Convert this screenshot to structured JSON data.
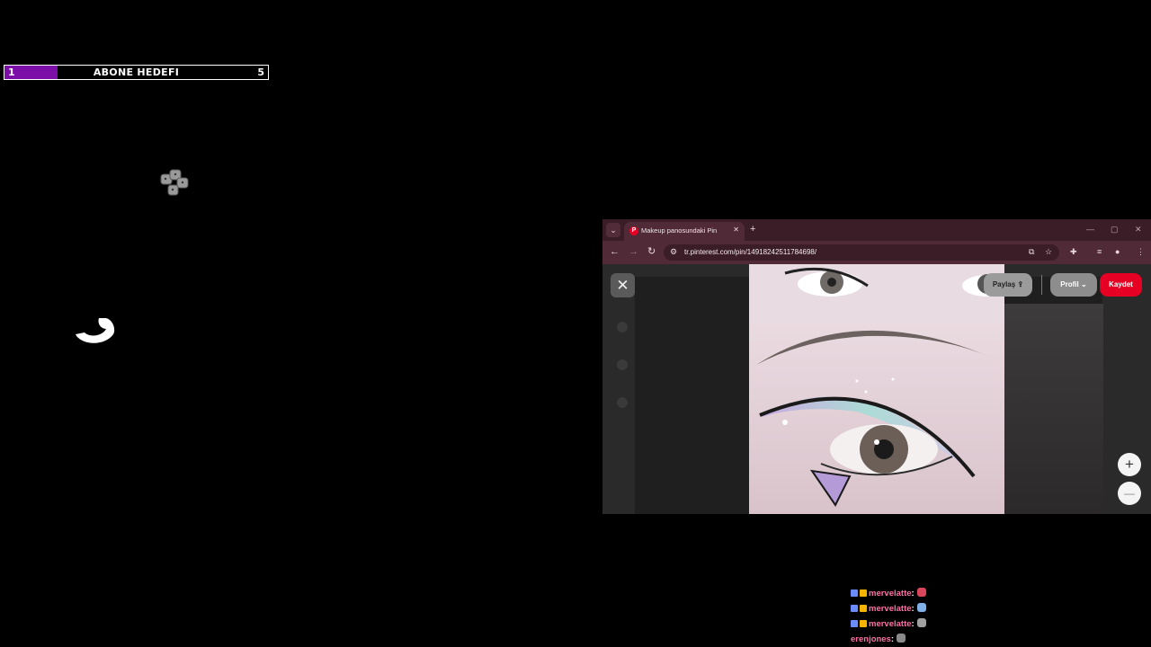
{
  "goal": {
    "start_label": "1",
    "title": "ABONE HEDEFI",
    "end_label": "5",
    "progress": 0.2
  },
  "browser": {
    "tab_title": "Makeup panosundaki Pin",
    "url": "tr.pinterest.com/pin/14918242511784698/",
    "share_label": "Paylaş",
    "profile_label": "Profil",
    "save_label": "Kaydet",
    "zoom_in_label": "+",
    "zoom_out_label": "—",
    "accent_color": "#e60023"
  },
  "chat": {
    "messages": [
      {
        "user": "mervelatte",
        "emote_color": "#d9465c"
      },
      {
        "user": "mervelatte",
        "emote_color": "#7fb0e8"
      },
      {
        "user": "mervelatte",
        "emote_color": "#a0a0a0"
      },
      {
        "user": "erenjones",
        "emote_color": "#8a8a8a"
      }
    ],
    "separator": ":"
  }
}
